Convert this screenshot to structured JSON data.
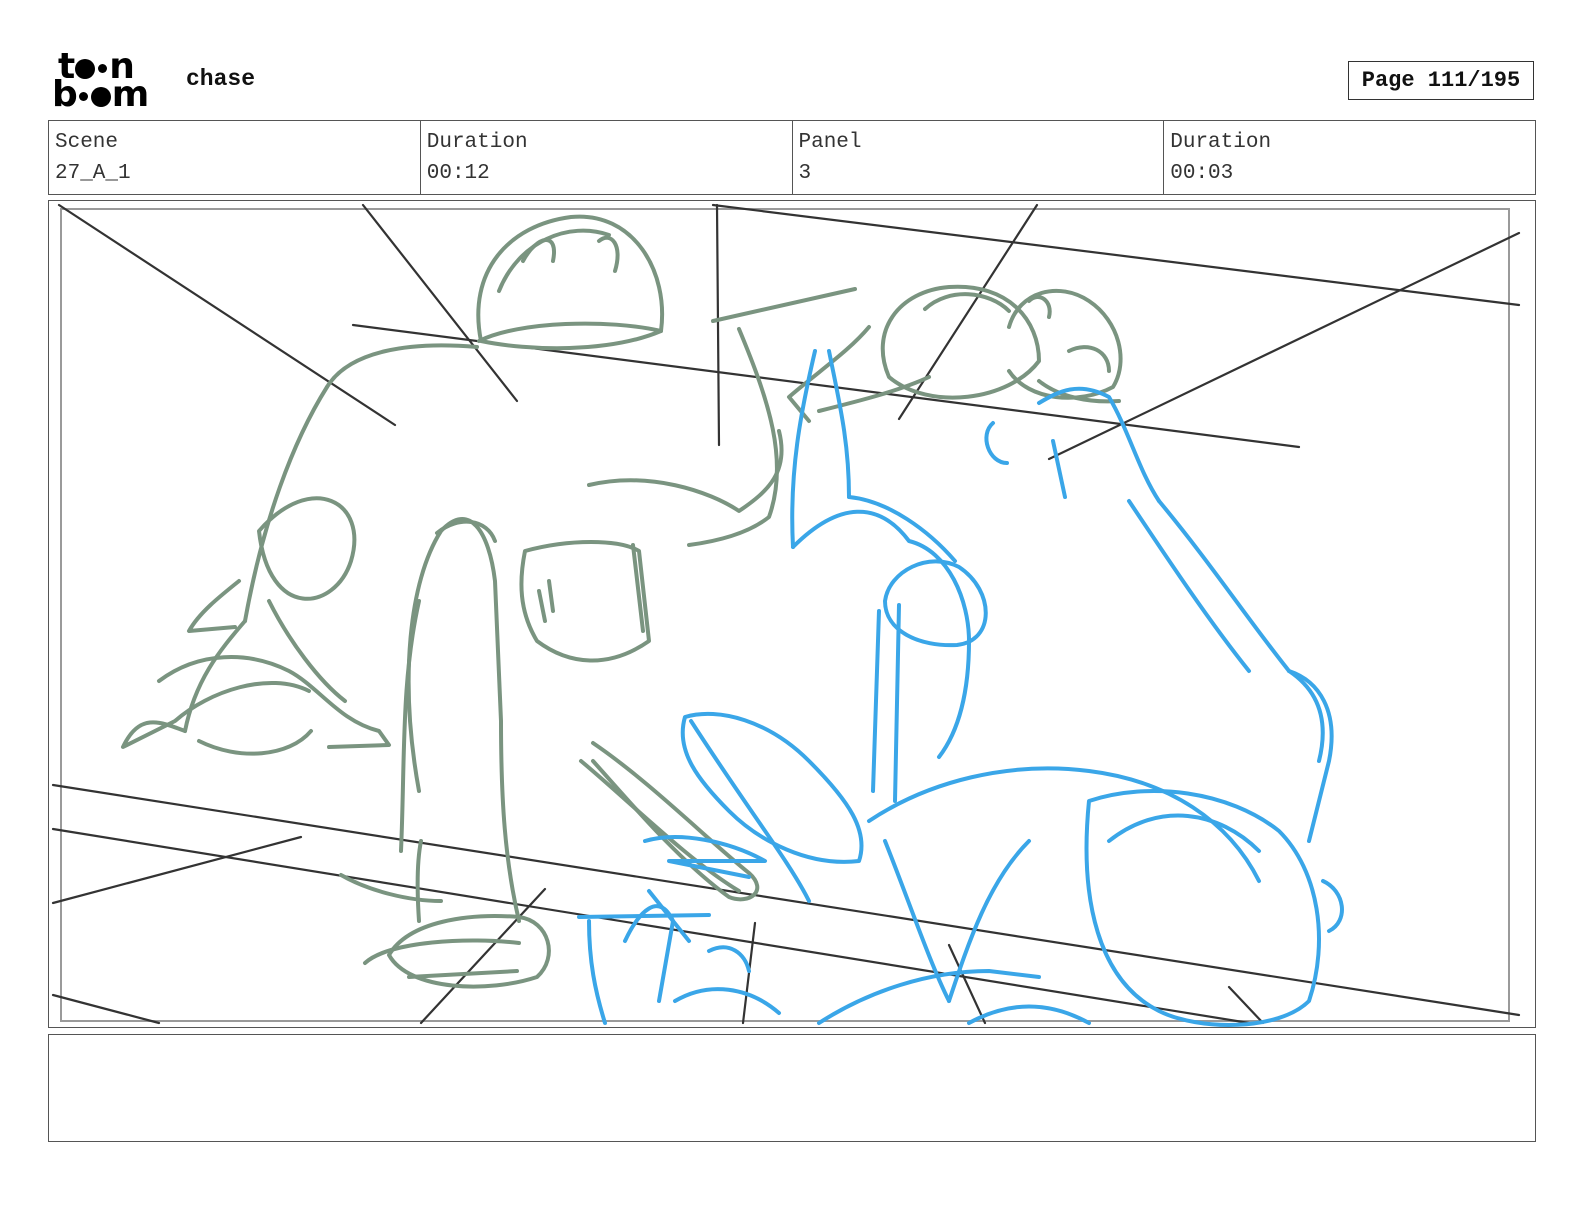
{
  "header": {
    "logo": {
      "row1": "t",
      "row1_tail": "n",
      "row2_head": "b",
      "row2_tail": "m",
      "icon": "toon-boom-logo"
    },
    "project_title": "chase",
    "page_label": "Page 111/195"
  },
  "info": [
    {
      "label": "Scene",
      "value": "27_A_1"
    },
    {
      "label": "Duration",
      "value": "00:12"
    },
    {
      "label": "Panel",
      "value": "3"
    },
    {
      "label": "Duration",
      "value": "00:03"
    }
  ],
  "notes": {
    "text": ""
  },
  "colors": {
    "sketch_green": "#7a9480",
    "sketch_blue": "#3aa6e8",
    "perspective_lines": "#333333",
    "frame_border": "#555555"
  }
}
